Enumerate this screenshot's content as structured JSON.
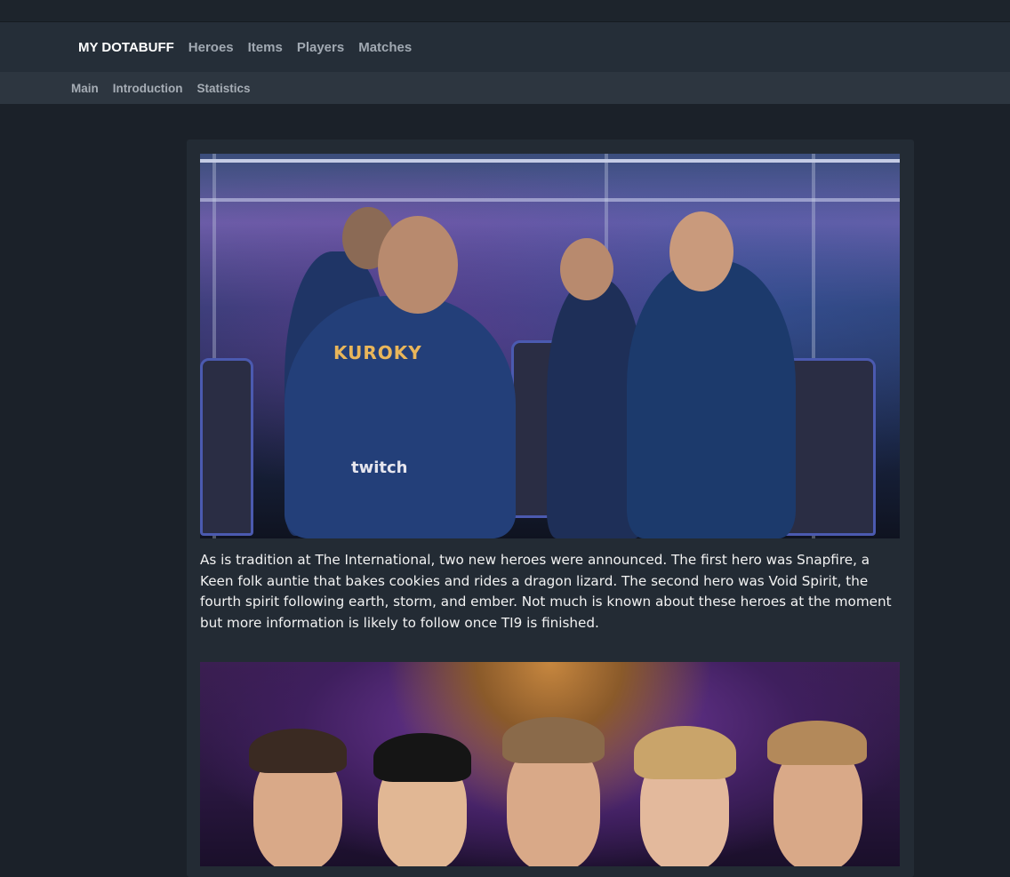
{
  "nav": {
    "brand": "MY DOTABUFF",
    "links": [
      "Heroes",
      "Items",
      "Players",
      "Matches"
    ]
  },
  "subnav": {
    "links": [
      "Main",
      "Introduction",
      "Statistics"
    ]
  },
  "article": {
    "image1_text": {
      "jersey": "KUROKY",
      "sponsor": "twitch"
    },
    "paragraph": "As is tradition at The International, two new heroes were announced. The first hero was Snapfire, a Keen folk auntie that bakes cookies and rides a dragon lizard. The second hero was Void Spirit, the fourth spirit following earth, storm, and ember. Not much is known about these heroes at the moment but more information is likely to follow once TI9 is finished."
  },
  "colors": {
    "page_bg": "#1b2129",
    "navbar_bg": "#252e38",
    "subnav_bg": "#2d3640",
    "card_bg": "#232b34"
  }
}
